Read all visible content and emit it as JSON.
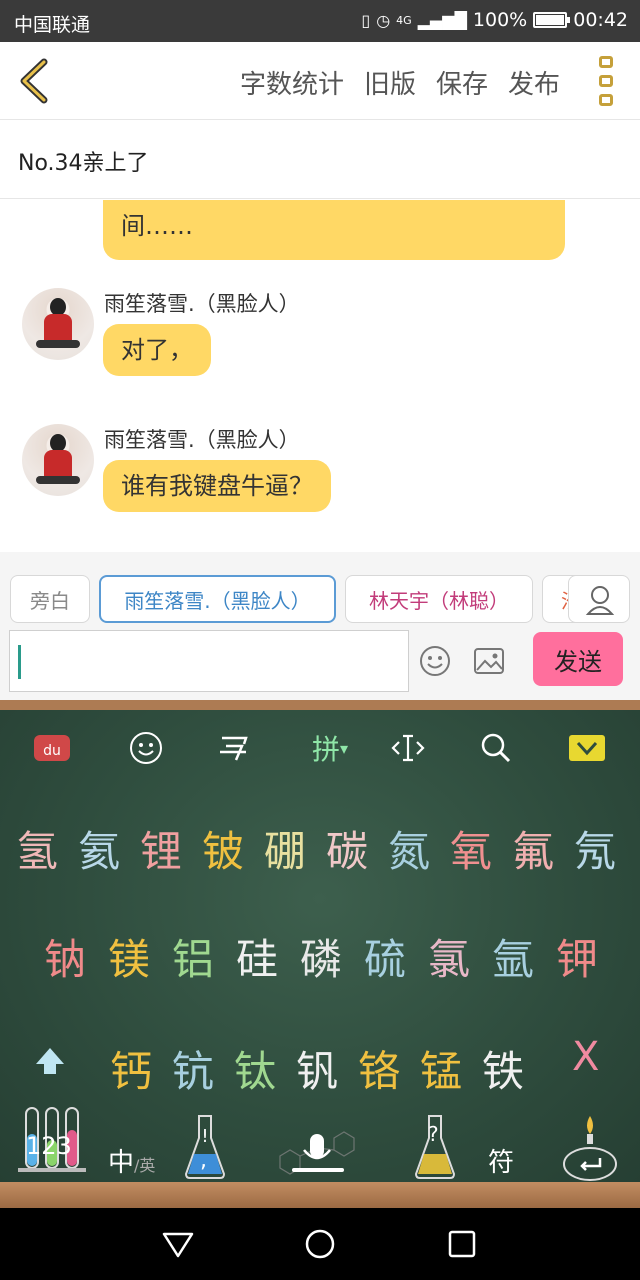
{
  "status_bar": {
    "carrier": "中国联通",
    "network": "4G",
    "battery": "100%",
    "time": "00:42",
    "battery_level": 1.0
  },
  "top_nav": {
    "actions": [
      "字数统计",
      "旧版",
      "保存",
      "发布"
    ]
  },
  "title": "No.34亲上了",
  "chat": {
    "messages": [
      {
        "sender": "",
        "text": "间……"
      },
      {
        "sender": "雨笙落雪.（黑脸人）",
        "text": "对了，"
      },
      {
        "sender": "雨笙落雪.（黑脸人）",
        "text": "谁有我键盘牛逼？"
      }
    ]
  },
  "roles": [
    {
      "label": "旁白",
      "color": "#8a8a8a"
    },
    {
      "label": "雨笙落雪.（黑脸人）",
      "color": "#3d86c6"
    },
    {
      "label": "林天宇（林聪）",
      "color": "#c23c7a"
    },
    {
      "label": "汐",
      "color": "#e06040"
    }
  ],
  "composer": {
    "input_value": "",
    "send_label": "发送"
  },
  "keyboard": {
    "top_row": [
      "拼"
    ],
    "candidates_row1": [
      "氢",
      "氦",
      "锂",
      "铍",
      "硼",
      "碳",
      "氮",
      "氧",
      "氟",
      "氖"
    ],
    "candidates_row2": [
      "钠",
      "镁",
      "铝",
      "硅",
      "磷",
      "硫",
      "氯",
      "氩",
      "钾"
    ],
    "candidates_row3": [
      "钙",
      "钪",
      "钛",
      "钒",
      "铬",
      "锰",
      "铁"
    ],
    "delete_key": "X",
    "numbers_key": "123",
    "lang_key_main": "中",
    "lang_key_sub": "/英",
    "comma_key": ",",
    "question_key": "?",
    "symbols_key": "符",
    "colors": {
      "row1": [
        "#f0b8b8",
        "#b8d8e8",
        "#f0a0a0",
        "#f0c040",
        "#e8e0a0",
        "#f0c8c8",
        "#a8d0e0",
        "#f09090",
        "#f0b0b0",
        "#b8d8e8"
      ],
      "row2": [
        "#f08a8a",
        "#f0c040",
        "#a0d890",
        "#f0f0f0",
        "#e8e8e8",
        "#a8d0e0",
        "#e8b8c8",
        "#a8d0e0",
        "#f08a8a"
      ],
      "row3": [
        "#f0c040",
        "#a8d0e0",
        "#a0d890",
        "#f0f0f0",
        "#f0c040",
        "#f0c040",
        "#f0f0f0"
      ]
    }
  }
}
